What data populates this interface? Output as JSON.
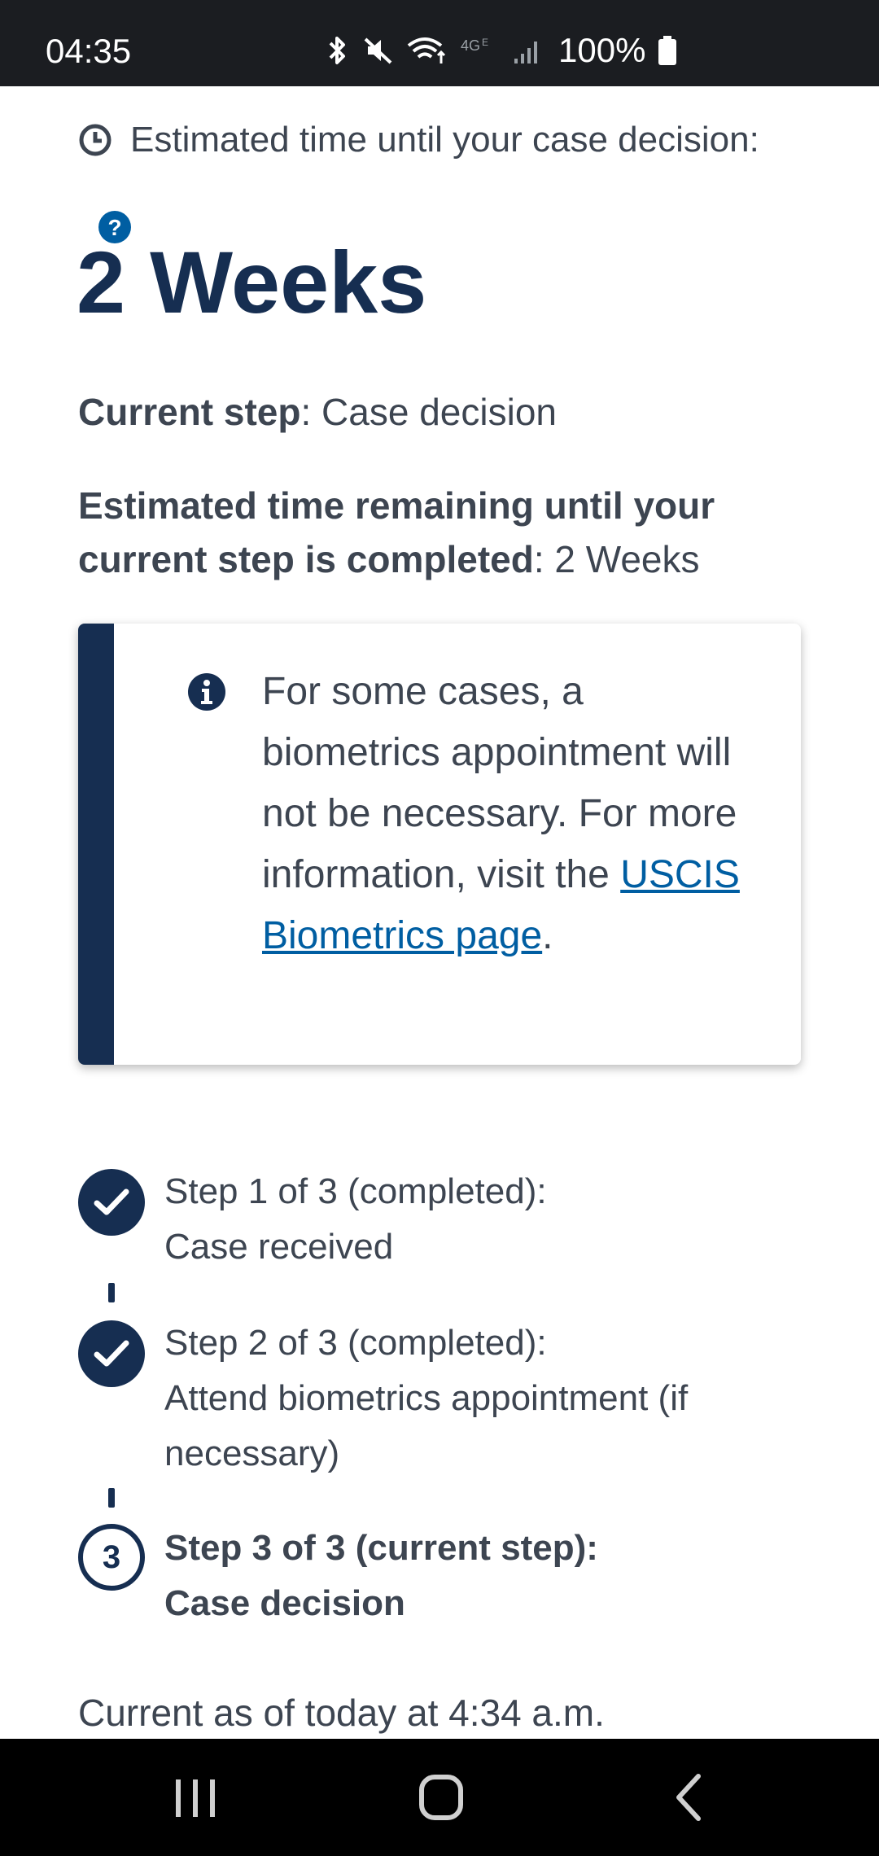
{
  "status_bar": {
    "time": "04:35",
    "battery": "100%",
    "icons": [
      "bluetooth-icon",
      "mute-icon",
      "wifi-icon",
      "4g-icon",
      "signal-icon",
      "battery-icon"
    ]
  },
  "case": {
    "estimated_label": "Estimated time until your case decision:",
    "estimate_value": "2 Weeks",
    "current_step_label": "Current step",
    "current_step_value": ": Case decision",
    "remaining_label": "Estimated time remaining until your current step is completed",
    "remaining_value": ": 2 Weeks"
  },
  "alert": {
    "text_before": "For some cases, a biometrics appointment will not be necessary. For more information, visit the ",
    "link_text": "USCIS Biometrics page",
    "text_after": "."
  },
  "steps": [
    {
      "title": "Step 1 of 3 (completed):",
      "description": "Case received",
      "status": "completed"
    },
    {
      "title": "Step 2 of 3 (completed):",
      "description": "Attend biometrics appointment (if necessary)",
      "status": "completed"
    },
    {
      "title": "Step 3 of 3 (current step):",
      "description": "Case decision",
      "status": "current",
      "number": "3"
    }
  ],
  "footer": {
    "updated_text": "Current as of today at 4:34 a.m."
  },
  "colors": {
    "navy": "#162e51",
    "link": "#005ea2",
    "text": "#3d4551"
  }
}
